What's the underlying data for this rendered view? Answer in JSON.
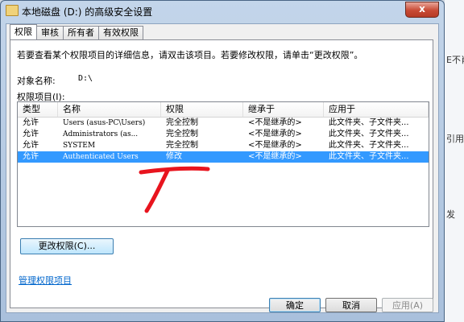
{
  "window": {
    "title": "本地磁盘 (D:) 的高级安全设置",
    "close_label": "x"
  },
  "tabs": [
    {
      "label": "权限"
    },
    {
      "label": "审核"
    },
    {
      "label": "所有者"
    },
    {
      "label": "有效权限"
    }
  ],
  "intro_text": "若要查看某个权限项目的详细信息，请双击该项目。若要修改权限，请单击“更改权限”。",
  "object": {
    "label": "对象名称:",
    "value": "D:\\"
  },
  "entries_label": "权限项目(I):",
  "grid": {
    "columns": [
      "类型",
      "名称",
      "权限",
      "继承于",
      "应用于"
    ],
    "rows": [
      {
        "type": "允许",
        "name": "Users (asus-PC\\Users)",
        "permission": "完全控制",
        "inherited": "<不是继承的>",
        "applies": "此文件夹、子文件夹..."
      },
      {
        "type": "允许",
        "name": "Administrators (as...",
        "permission": "完全控制",
        "inherited": "<不是继承的>",
        "applies": "此文件夹、子文件夹..."
      },
      {
        "type": "允许",
        "name": "SYSTEM",
        "permission": "完全控制",
        "inherited": "<不是继承的>",
        "applies": "此文件夹、子文件夹..."
      },
      {
        "type": "允许",
        "name": "Authenticated Users",
        "permission": "修改",
        "inherited": "<不是继承的>",
        "applies": "此文件夹、子文件夹..."
      }
    ],
    "selected_row": 3
  },
  "change_button": "更改权限(C)...",
  "manage_link": "管理权限项目",
  "buttons": {
    "ok": "确定",
    "cancel": "取消",
    "apply": "应用(A)"
  },
  "background_fragments": [
    "E不肖",
    "引用",
    "发"
  ],
  "colors": {
    "selection": "#3399ff",
    "annotation": "#e8141e"
  }
}
